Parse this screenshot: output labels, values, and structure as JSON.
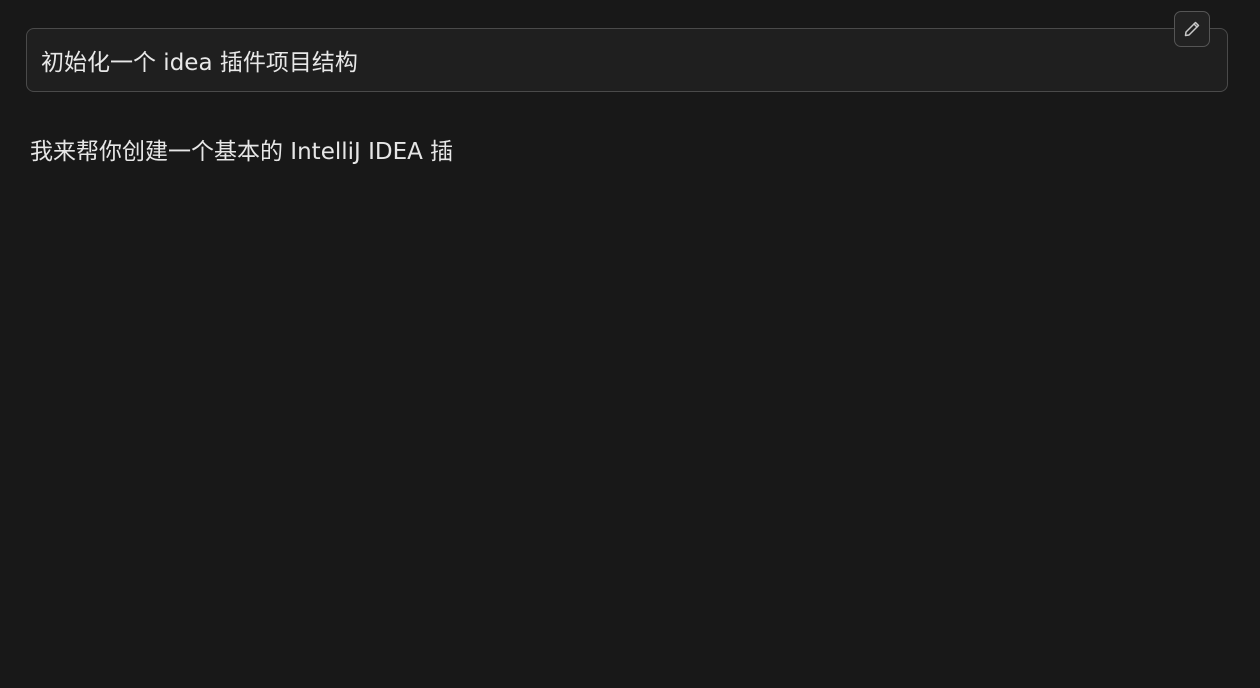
{
  "user_message": {
    "text": "初始化一个 idea 插件项目结构"
  },
  "edit_button": {
    "icon": "pencil-icon"
  },
  "assistant_message": {
    "text": "我来帮你创建一个基本的 IntelliJ IDEA 插"
  },
  "colors": {
    "background": "#181818",
    "bubble_background": "#1f1f1f",
    "bubble_border": "#4a4a4a",
    "text": "#e6e6e6"
  }
}
